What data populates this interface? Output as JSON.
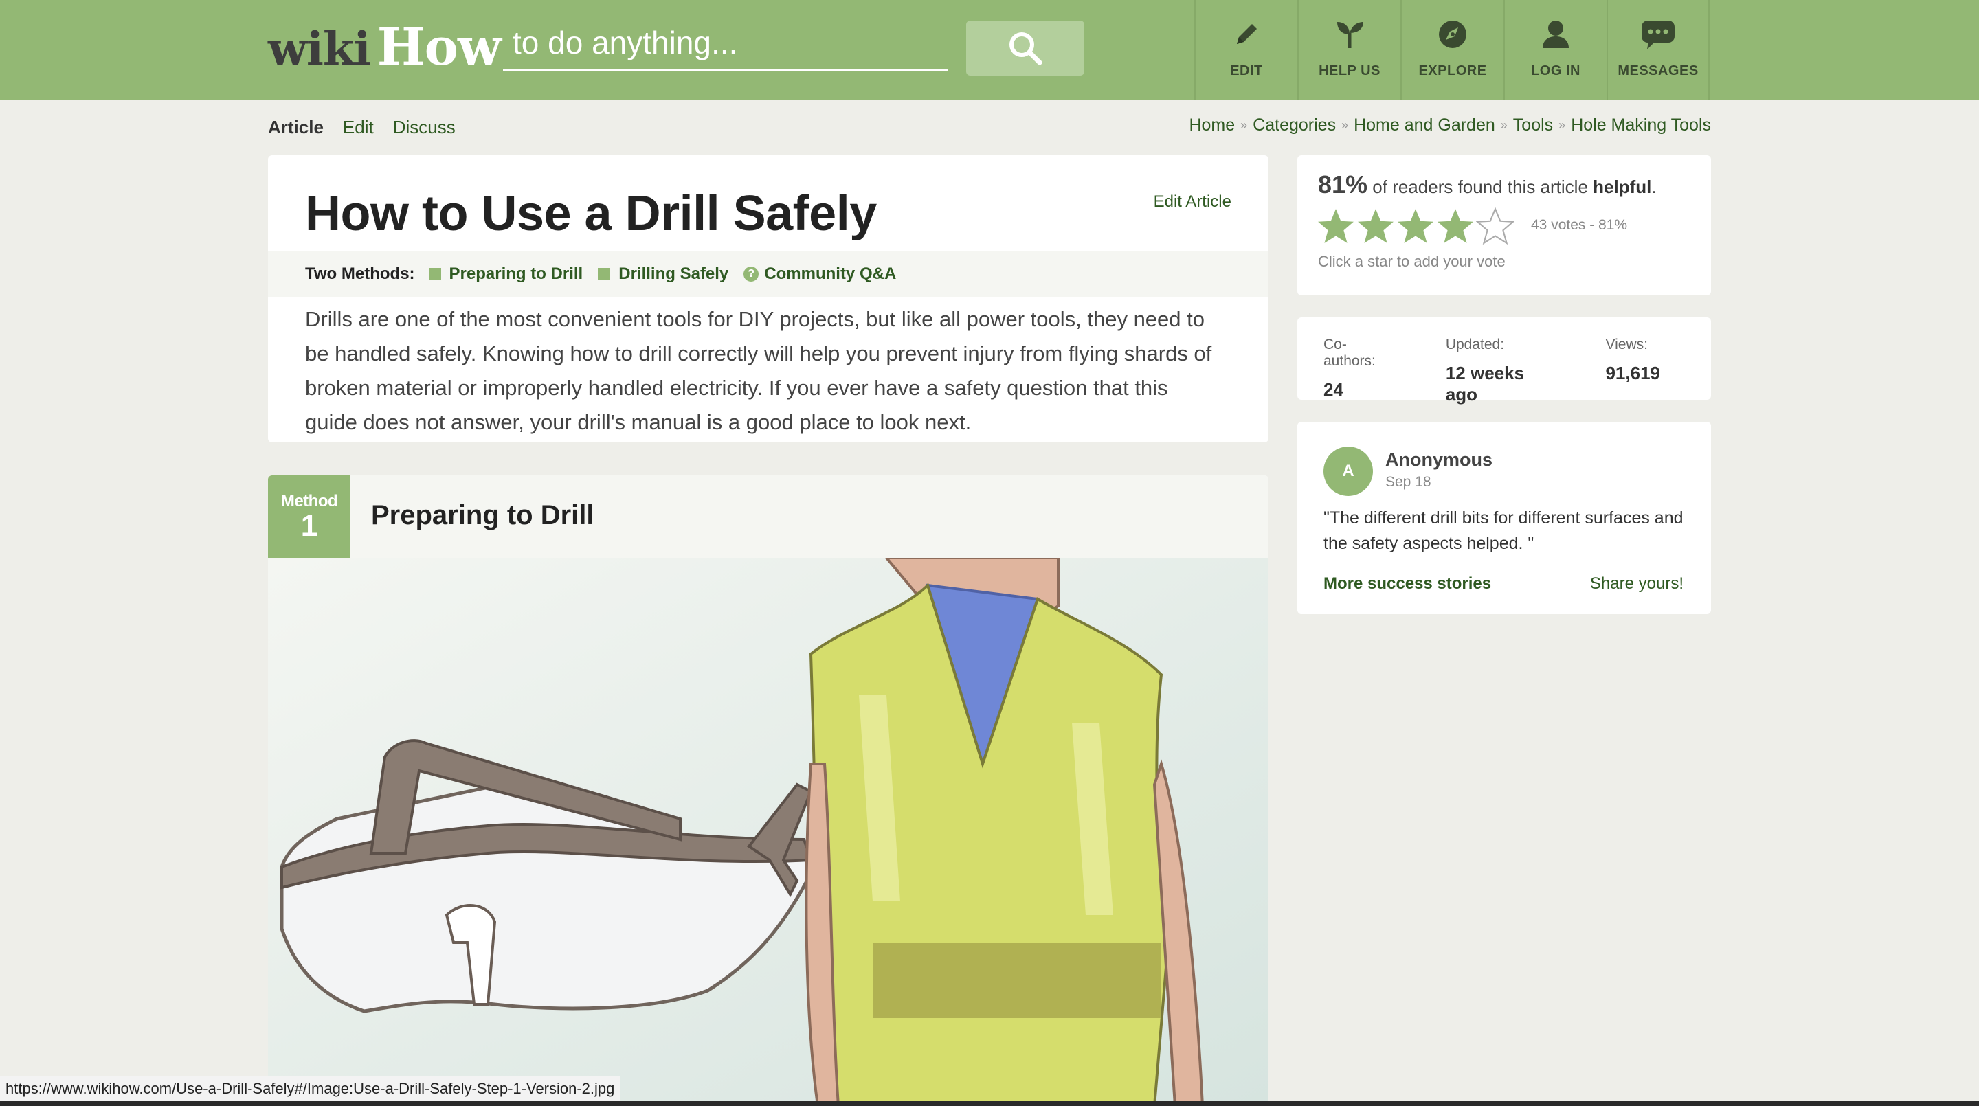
{
  "logo": {
    "wiki": "wiki",
    "how": "How"
  },
  "search": {
    "placeholder": "to do anything..."
  },
  "nav": [
    {
      "label": "EDIT",
      "icon": "pencil-icon"
    },
    {
      "label": "HELP US",
      "icon": "sprout-icon"
    },
    {
      "label": "EXPLORE",
      "icon": "compass-icon"
    },
    {
      "label": "LOG IN",
      "icon": "user-icon"
    },
    {
      "label": "MESSAGES",
      "icon": "chat-bubble-icon"
    }
  ],
  "tabs": {
    "article": "Article",
    "edit": "Edit",
    "discuss": "Discuss"
  },
  "breadcrumb": {
    "sep": "»",
    "items": [
      "Home",
      "Categories",
      "Home and Garden",
      "Tools",
      "Hole Making Tools"
    ]
  },
  "article": {
    "title": "How to Use a Drill Safely",
    "edit_link": "Edit Article",
    "methods_lead": "Two Methods:",
    "methods": [
      "Preparing to Drill",
      "Drilling Safely"
    ],
    "qa_icon": "?",
    "qa": "Community Q&A",
    "intro": "Drills are one of the most convenient tools for DIY projects, but like all power tools, they need to be handled safely. Knowing how to drill correctly will help you prevent injury from flying shards of broken material or improperly handled electricity. If you ever have a safety question that this guide does not answer, your drill's manual is a good place to look next."
  },
  "method1": {
    "badge_word": "Method",
    "badge_num": "1",
    "title": "Preparing to Drill"
  },
  "rating": {
    "percent": "81%",
    "text_mid": " of readers found this article ",
    "text_bold": "helpful",
    "text_end": ".",
    "stars": 4,
    "stars_max": 5,
    "votes": "43 votes - 81%",
    "hint": "Click a star to add your vote"
  },
  "stats": {
    "coauthors_label": "Co-authors:",
    "coauthors": "24",
    "updated_label": "Updated:",
    "updated": "12 weeks ago",
    "views_label": "Views:",
    "views": "91,619"
  },
  "story": {
    "avatar": "A",
    "name": "Anonymous",
    "date": "Sep 18",
    "quote": "\"The different drill bits for different surfaces and the safety aspects helped. \"",
    "more": "More success stories",
    "share": "Share yours!"
  },
  "status_url": "https://www.wikihow.com/Use-a-Drill-Safely#/Image:Use-a-Drill-Safely-Step-1-Version-2.jpg",
  "colors": {
    "brand_green": "#93b874",
    "link_green": "#2f5a22",
    "page_bg": "#eeeee9"
  }
}
